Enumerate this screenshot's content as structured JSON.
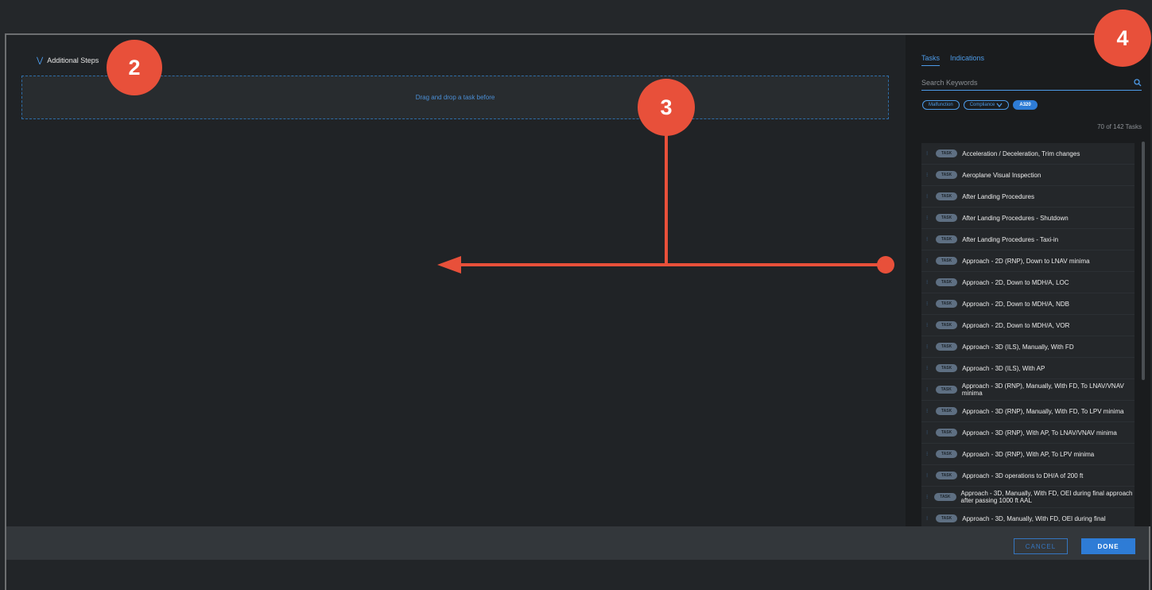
{
  "main": {
    "section_title": "Additional Steps",
    "dropzone_text": "Drag and drop a task before"
  },
  "sidebar": {
    "tabs": [
      {
        "label": "Tasks",
        "active": true
      },
      {
        "label": "Indications",
        "active": false
      }
    ],
    "search": {
      "placeholder": "Search Keywords",
      "value": ""
    },
    "filters": [
      {
        "label": "Malfunction",
        "style": "outline"
      },
      {
        "label": "Compliance",
        "style": "outline-dropdown"
      },
      {
        "label": "A320",
        "style": "filled"
      }
    ],
    "count_text": "70 of 142 Tasks",
    "badge_label": "TASK",
    "tasks": [
      "Acceleration / Deceleration, Trim changes",
      "Aeroplane Visual Inspection",
      "After Landing Procedures",
      "After Landing Procedures - Shutdown",
      "After Landing Procedures - Taxi-in",
      "Approach - 2D (RNP), Down to LNAV minima",
      "Approach - 2D, Down to MDH/A, LOC",
      "Approach - 2D, Down to MDH/A, NDB",
      "Approach - 2D, Down to MDH/A, VOR",
      "Approach - 3D (ILS), Manually, With FD",
      "Approach - 3D (ILS), With AP",
      "Approach - 3D (RNP), Manually, With FD, To LNAV/VNAV minima",
      "Approach - 3D (RNP), Manually, With FD, To LPV minima",
      "Approach - 3D (RNP), With AP, To LNAV/VNAV minima",
      "Approach - 3D (RNP), With AP, To LPV minima",
      "Approach - 3D operations to DH/A of 200 ft",
      "Approach - 3D, Manually, With FD, OEI during final approach after passing 1000 ft AAL",
      "Approach - 3D, Manually, With FD, OEI during final"
    ]
  },
  "footer": {
    "cancel_label": "CANCEL",
    "done_label": "DONE"
  },
  "annotations": [
    "2",
    "3",
    "4"
  ],
  "colors": {
    "accent": "#4d9be8",
    "annotation": "#e8503a",
    "badge": "#5e6f82"
  }
}
